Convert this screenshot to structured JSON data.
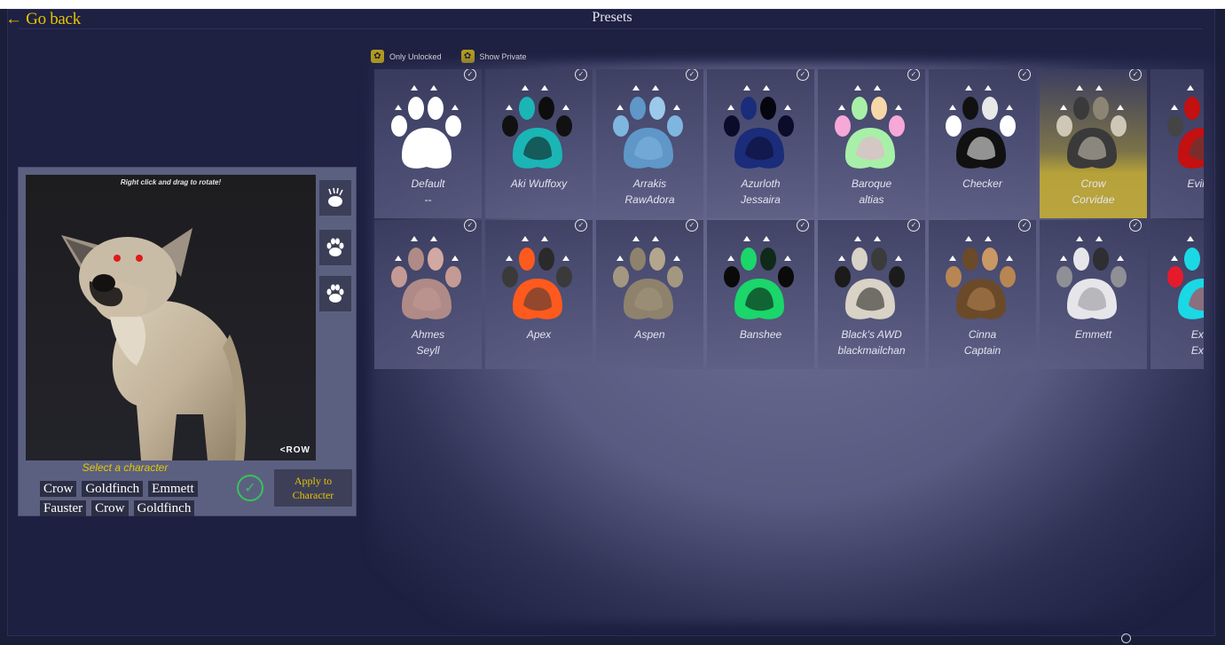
{
  "header": {
    "back_label": "← Go back",
    "title": "Presets"
  },
  "filters": [
    {
      "label": "Only Unlocked",
      "icon": "paw-icon"
    },
    {
      "label": "Show Private",
      "icon": "paw-icon"
    }
  ],
  "presets_row1": [
    {
      "line1": "Default",
      "line2": "--",
      "style": "white"
    },
    {
      "line1": "Aki Wuffoxy",
      "line2": "",
      "style": "teal"
    },
    {
      "line1": "Arrakis",
      "line2": "RawAdora",
      "style": "blue"
    },
    {
      "line1": "Azurloth",
      "line2": "Jessaira",
      "style": "navy"
    },
    {
      "line1": "Baroque",
      "line2": "altias",
      "style": "rainbow"
    },
    {
      "line1": "Checker",
      "line2": "",
      "style": "checker"
    },
    {
      "line1": "Crow",
      "line2": "Corvidae",
      "style": "crow",
      "selected": true
    },
    {
      "line1": "Evil Ho",
      "line2": "",
      "style": "evil"
    }
  ],
  "presets_row2": [
    {
      "line1": "Ahmes",
      "line2": "Seyll",
      "style": "pink"
    },
    {
      "line1": "Apex",
      "line2": "",
      "style": "apex"
    },
    {
      "line1": "Aspen",
      "line2": "",
      "style": "aspen"
    },
    {
      "line1": "Banshee",
      "line2": "",
      "style": "banshee"
    },
    {
      "line1": "Black's AWD",
      "line2": "blackmailchan",
      "style": "blackawd"
    },
    {
      "line1": "Cinna",
      "line2": "Captain",
      "style": "cinna"
    },
    {
      "line1": "Emmett",
      "line2": "",
      "style": "emmett"
    },
    {
      "line1": "Exisn",
      "line2": "Exisn",
      "style": "exisn"
    }
  ],
  "preview": {
    "rotate_hint": "Right click and drag to rotate!",
    "character_label": "<ROW"
  },
  "character_select": {
    "label": "Select a character",
    "row1": [
      "Crow",
      "Goldfinch",
      "Emmett"
    ],
    "row2": [
      "Fauster",
      "Crow",
      "Goldfinch"
    ],
    "apply_line1": "Apply to",
    "apply_line2": "Character"
  },
  "colors": {
    "accent": "#e8c300",
    "selected_card": "#b9a43e",
    "confirm": "#39c25a",
    "background": "#1b1e38"
  }
}
